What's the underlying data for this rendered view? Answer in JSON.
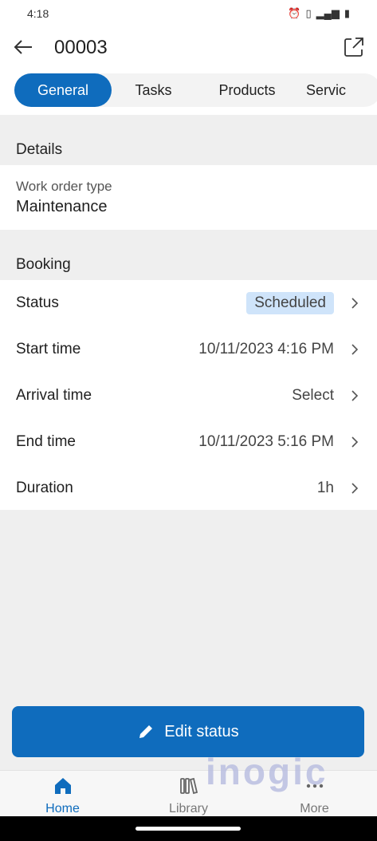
{
  "status_bar": {
    "time": "4:18"
  },
  "header": {
    "title": "00003"
  },
  "tabs": [
    {
      "label": "General",
      "active": true
    },
    {
      "label": "Tasks",
      "active": false
    },
    {
      "label": "Products",
      "active": false
    },
    {
      "label": "Servic",
      "active": false
    }
  ],
  "details": {
    "section_label": "Details",
    "work_order_type_label": "Work order type",
    "work_order_type_value": "Maintenance"
  },
  "booking": {
    "section_label": "Booking",
    "rows": [
      {
        "label": "Status",
        "value": "Scheduled",
        "badge": true
      },
      {
        "label": "Start time",
        "value": "10/11/2023 4:16 PM"
      },
      {
        "label": "Arrival time",
        "value": "Select"
      },
      {
        "label": "End time",
        "value": "10/11/2023 5:16 PM"
      },
      {
        "label": "Duration",
        "value": "1h"
      }
    ]
  },
  "actions": {
    "edit_status_label": "Edit status"
  },
  "bottom_nav": [
    {
      "label": "Home",
      "icon": "home-icon",
      "active": true
    },
    {
      "label": "Library",
      "icon": "library-icon",
      "active": false
    },
    {
      "label": "More",
      "icon": "more-icon",
      "active": false
    }
  ],
  "watermark": "inogic",
  "colors": {
    "accent": "#0f6cbd",
    "badge_bg": "#cfe4fa",
    "background": "#efefef"
  }
}
